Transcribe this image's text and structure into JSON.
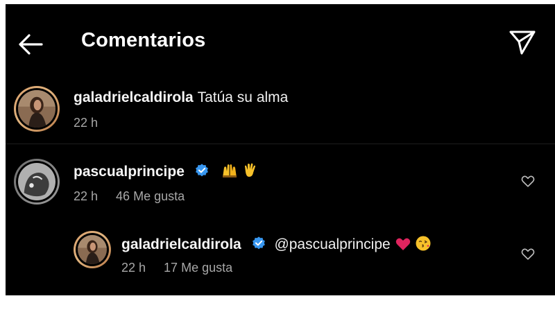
{
  "header": {
    "title": "Comentarios",
    "back_icon": "arrow-left-icon",
    "share_icon": "paper-plane-icon"
  },
  "colors": {
    "background": "#000000",
    "verified": "#3897f0",
    "heart_emoji": "#e0245e",
    "meta_text": "#a8a8a8"
  },
  "comments": [
    {
      "username": "galadrielcaldirola",
      "verified": false,
      "text": "Tatúa su alma",
      "time": "22 h",
      "likes": ""
    },
    {
      "username": "pascualprincipe",
      "verified": true,
      "text": "",
      "emojis": [
        "raising-hands-emoji",
        "waving-hand-emoji"
      ],
      "time": "22 h",
      "likes": "46 Me gusta"
    },
    {
      "username": "galadrielcaldirola",
      "verified": true,
      "text": "@pascualprincipe",
      "emojis": [
        "red-heart-emoji",
        "kissing-face-emoji"
      ],
      "time": "22 h",
      "likes": "17 Me gusta",
      "is_reply": true
    }
  ]
}
